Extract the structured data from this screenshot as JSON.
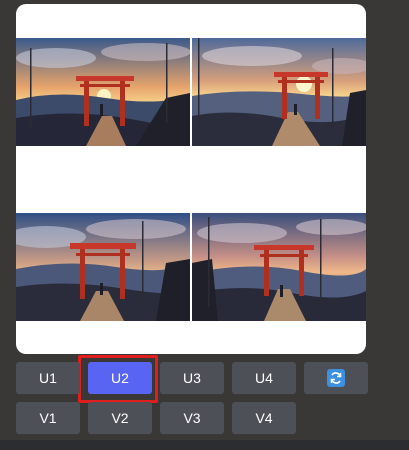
{
  "upscale_buttons": [
    "U1",
    "U2",
    "U3",
    "U4"
  ],
  "variation_buttons": [
    "V1",
    "V2",
    "V3",
    "V4"
  ],
  "selected_button": "U2",
  "reroll_icon": "refresh-icon",
  "colors": {
    "background": "#3a3836",
    "button": "#4e5058",
    "button_selected": "#5865f2",
    "highlight": "#e01e1e",
    "refresh": "#3d8fe0"
  }
}
